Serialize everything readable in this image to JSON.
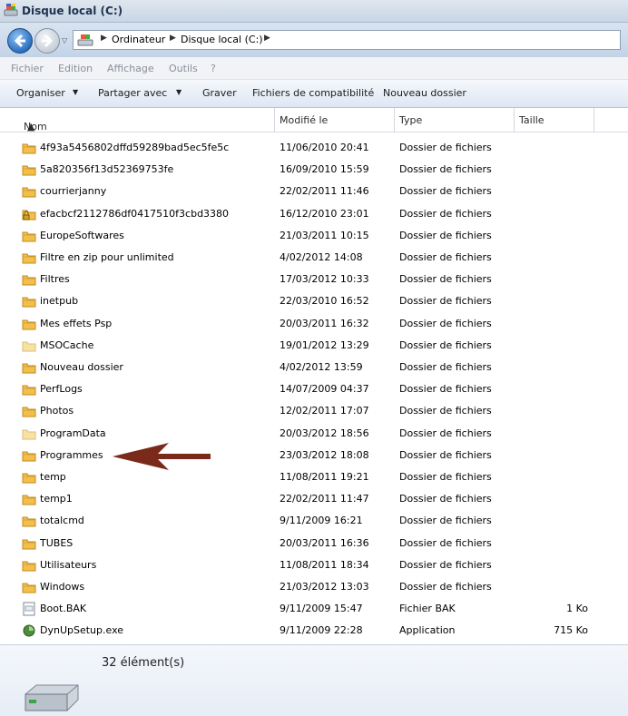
{
  "window": {
    "title": "Disque local (C:)"
  },
  "address": {
    "crumbs": [
      "Ordinateur",
      "Disque local (C:)"
    ]
  },
  "menu": [
    "Fichier",
    "Edition",
    "Affichage",
    "Outils",
    "?"
  ],
  "commands": {
    "organize": "Organiser",
    "share": "Partager avec",
    "burn": "Graver",
    "compat": "Fichiers de compatibilité",
    "newfolder": "Nouveau dossier"
  },
  "columns": {
    "name": "Nom",
    "modified": "Modifié le",
    "type": "Type",
    "size": "Taille"
  },
  "files": [
    {
      "name": "4f93a5456802dffd59289bad5ec5fe5c",
      "date": "11/06/2010 20:41",
      "type": "Dossier de fichiers",
      "size": "",
      "icon": "folder-icon"
    },
    {
      "name": "5a820356f13d52369753fe",
      "date": "16/09/2010 15:59",
      "type": "Dossier de fichiers",
      "size": "",
      "icon": "folder-icon"
    },
    {
      "name": "courrierjanny",
      "date": "22/02/2011 11:46",
      "type": "Dossier de fichiers",
      "size": "",
      "icon": "folder-icon"
    },
    {
      "name": "efacbcf2112786df0417510f3cbd3380",
      "date": "16/12/2010 23:01",
      "type": "Dossier de fichiers",
      "size": "",
      "icon": "locked-folder-icon"
    },
    {
      "name": "EuropeSoftwares",
      "date": "21/03/2011 10:15",
      "type": "Dossier de fichiers",
      "size": "",
      "icon": "folder-icon"
    },
    {
      "name": "Filtre en zip pour unlimited",
      "date": "4/02/2012 14:08",
      "type": "Dossier de fichiers",
      "size": "",
      "icon": "folder-icon"
    },
    {
      "name": "Filtres",
      "date": "17/03/2012 10:33",
      "type": "Dossier de fichiers",
      "size": "",
      "icon": "folder-icon"
    },
    {
      "name": "inetpub",
      "date": "22/03/2010 16:52",
      "type": "Dossier de fichiers",
      "size": "",
      "icon": "folder-icon"
    },
    {
      "name": "Mes effets Psp",
      "date": "20/03/2011 16:32",
      "type": "Dossier de fichiers",
      "size": "",
      "icon": "folder-icon"
    },
    {
      "name": "MSOCache",
      "date": "19/01/2012 13:29",
      "type": "Dossier de fichiers",
      "size": "",
      "icon": "hidden-folder-icon"
    },
    {
      "name": "Nouveau dossier",
      "date": "4/02/2012 13:59",
      "type": "Dossier de fichiers",
      "size": "",
      "icon": "folder-icon"
    },
    {
      "name": "PerfLogs",
      "date": "14/07/2009 04:37",
      "type": "Dossier de fichiers",
      "size": "",
      "icon": "folder-icon"
    },
    {
      "name": "Photos",
      "date": "12/02/2011 17:07",
      "type": "Dossier de fichiers",
      "size": "",
      "icon": "folder-icon"
    },
    {
      "name": "ProgramData",
      "date": "20/03/2012 18:56",
      "type": "Dossier de fichiers",
      "size": "",
      "icon": "hidden-folder-icon"
    },
    {
      "name": "Programmes",
      "date": "23/03/2012 18:08",
      "type": "Dossier de fichiers",
      "size": "",
      "icon": "folder-icon"
    },
    {
      "name": "temp",
      "date": "11/08/2011 19:21",
      "type": "Dossier de fichiers",
      "size": "",
      "icon": "folder-icon"
    },
    {
      "name": "temp1",
      "date": "22/02/2011 11:47",
      "type": "Dossier de fichiers",
      "size": "",
      "icon": "folder-icon"
    },
    {
      "name": "totalcmd",
      "date": "9/11/2009 16:21",
      "type": "Dossier de fichiers",
      "size": "",
      "icon": "folder-icon"
    },
    {
      "name": "TUBES",
      "date": "20/03/2011 16:36",
      "type": "Dossier de fichiers",
      "size": "",
      "icon": "folder-icon"
    },
    {
      "name": "Utilisateurs",
      "date": "11/08/2011 18:34",
      "type": "Dossier de fichiers",
      "size": "",
      "icon": "folder-icon"
    },
    {
      "name": "Windows",
      "date": "21/03/2012 13:03",
      "type": "Dossier de fichiers",
      "size": "",
      "icon": "folder-icon"
    },
    {
      "name": "Boot.BAK",
      "date": "9/11/2009 15:47",
      "type": "Fichier BAK",
      "size": "1 Ko",
      "icon": "bak-file-icon"
    },
    {
      "name": "DynUpSetup.exe",
      "date": "9/11/2009 22:28",
      "type": "Application",
      "size": "715 Ko",
      "icon": "setup-exe-icon"
    }
  ],
  "status": {
    "count": "32 élément(s)"
  },
  "colors": {
    "annotation_arrow": "#7a2a1a",
    "folder": "#e8b13a"
  }
}
